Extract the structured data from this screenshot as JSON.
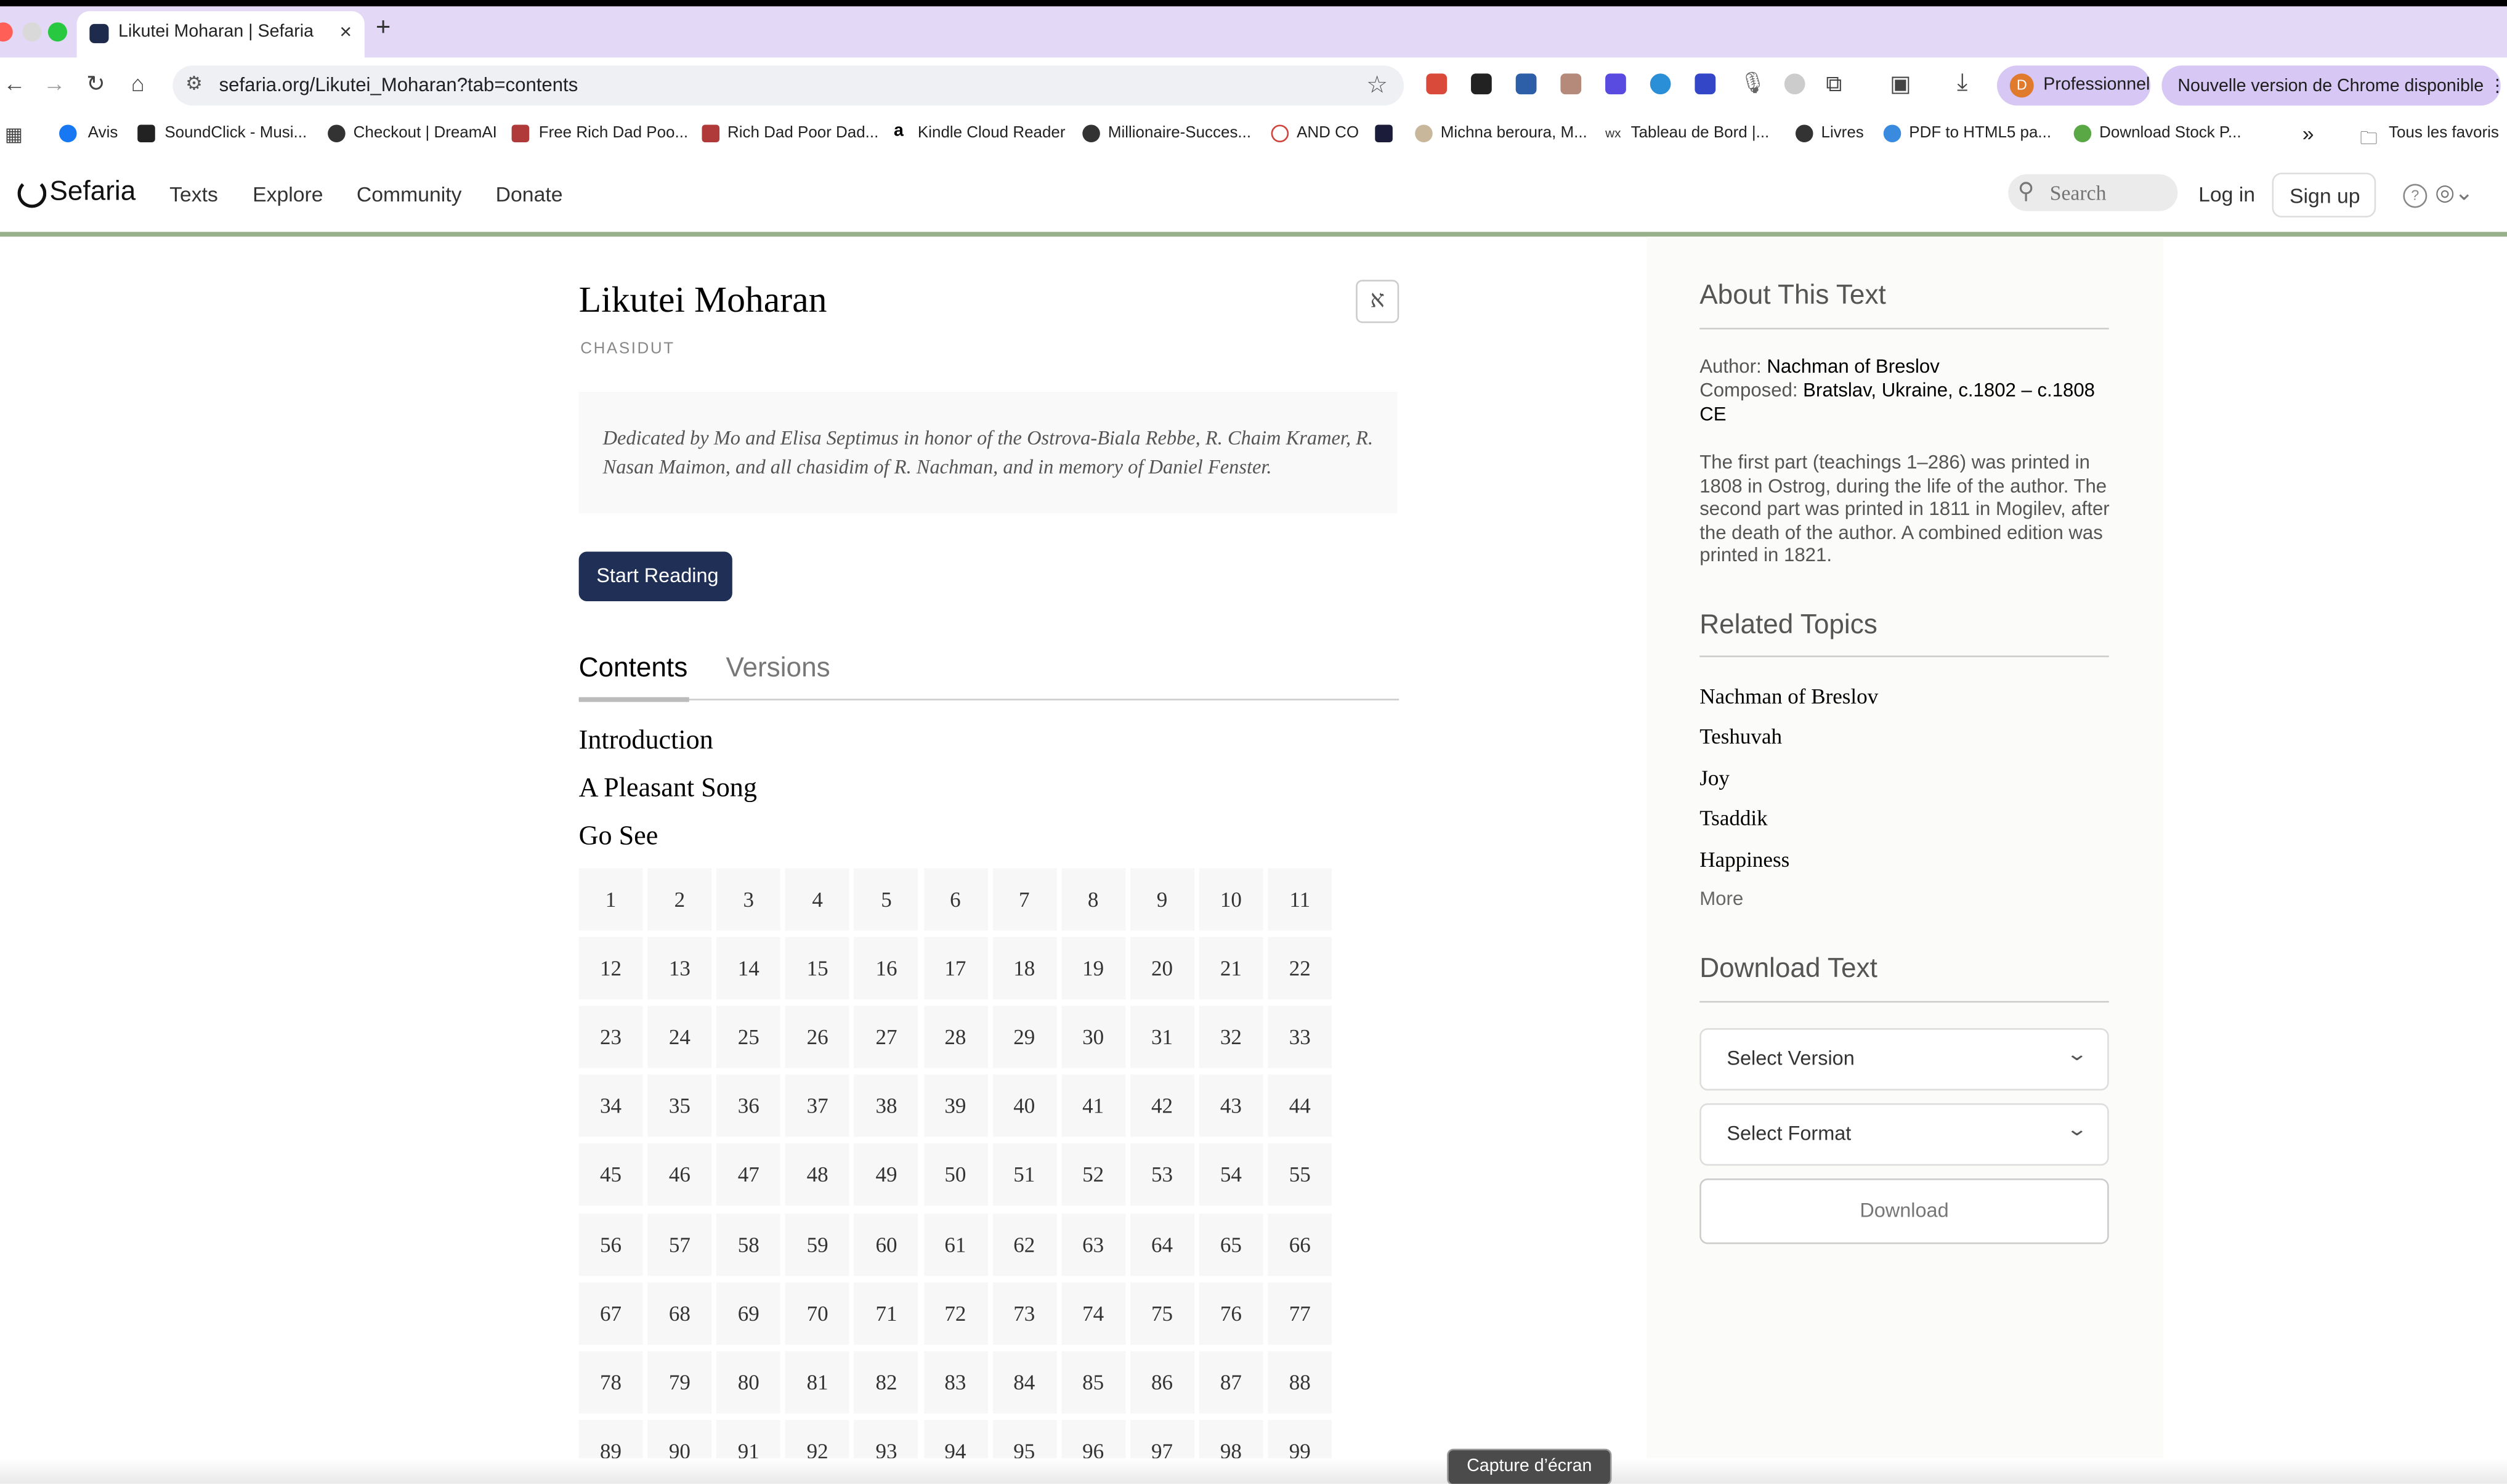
{
  "browser": {
    "tab_title": "Likutei Moharan | Sefaria",
    "new_tab": "+",
    "close": "×",
    "url": "sefaria.org/Likutei_Moharan?tab=contents",
    "profile_initial": "D",
    "profile_label": "Professionnel",
    "update_label": "Nouvelle version de Chrome disponible",
    "bookmarks": [
      "Avis",
      "SoundClick - Musi...",
      "Checkout | DreamAI",
      "Free Rich Dad Poo...",
      "Rich Dad Poor Dad...",
      "Kindle Cloud Reader",
      "Millionaire-Succes...",
      "AND CO",
      "Michna beroura, M...",
      "Tableau de Bord |...",
      "Livres",
      "PDF to HTML5 pa...",
      "Download Stock P..."
    ],
    "bookmarks_overflow": "»",
    "all_bookmarks": "Tous les favoris"
  },
  "site": {
    "logo": "Sefaria",
    "nav": [
      "Texts",
      "Explore",
      "Community",
      "Donate"
    ],
    "search_placeholder": "Search",
    "login": "Log in",
    "signup": "Sign up"
  },
  "book": {
    "title": "Likutei Moharan",
    "hebrew_toggle": "א",
    "category": "CHASIDUT",
    "dedication": "Dedicated by Mo and Elisa Septimus in honor of the Ostrova-Biala Rebbe, R. Chaim Kramer, R. Nasan Maimon, and all chasidim of R. Nachman, and in memory of Daniel Fenster.",
    "start_reading": "Start Reading",
    "tabs": [
      "Contents",
      "Versions"
    ],
    "toc": [
      "Introduction",
      "A Pleasant Song",
      "Go See"
    ],
    "sections": [
      "1",
      "2",
      "3",
      "4",
      "5",
      "6",
      "7",
      "8",
      "9",
      "10",
      "11",
      "12",
      "13",
      "14",
      "15",
      "16",
      "17",
      "18",
      "19",
      "20",
      "21",
      "22",
      "23",
      "24",
      "25",
      "26",
      "27",
      "28",
      "29",
      "30",
      "31",
      "32",
      "33",
      "34",
      "35",
      "36",
      "37",
      "38",
      "39",
      "40",
      "41",
      "42",
      "43",
      "44",
      "45",
      "46",
      "47",
      "48",
      "49",
      "50",
      "51",
      "52",
      "53",
      "54",
      "55",
      "56",
      "57",
      "58",
      "59",
      "60",
      "61",
      "62",
      "63",
      "64",
      "65",
      "66",
      "67",
      "68",
      "69",
      "70",
      "71",
      "72",
      "73",
      "74",
      "75",
      "76",
      "77",
      "78",
      "79",
      "80",
      "81",
      "82",
      "83",
      "84",
      "85",
      "86",
      "87",
      "88",
      "89",
      "90",
      "91",
      "92",
      "93",
      "94",
      "95",
      "96",
      "97",
      "98",
      "99"
    ]
  },
  "sidebar": {
    "about_heading": "About This Text",
    "author_label": "Author: ",
    "author": "Nachman of Breslov",
    "composed_label": "Composed: ",
    "composed": "Bratslav, Ukraine, c.1802 – c.1808 CE",
    "description": "The first part (teachings 1–286) was printed in 1808 in Ostrog, during the life of the author. The second part was printed in 1811 in Mogilev, after the death of the author. A combined edition was printed in 1821.",
    "topics_heading": "Related Topics",
    "topics": [
      "Nachman of Breslov",
      "Teshuvah",
      "Joy",
      "Tsaddik",
      "Happiness"
    ],
    "more": "More",
    "download_heading": "Download Text",
    "select_version": "Select Version",
    "select_format": "Select Format",
    "download": "Download"
  },
  "tooltip": "Capture d’écran",
  "colors": {
    "tabstrip": "#e3d9f7",
    "sefaria_blue": "#1f2f55",
    "header_rule": "#99b18b"
  }
}
